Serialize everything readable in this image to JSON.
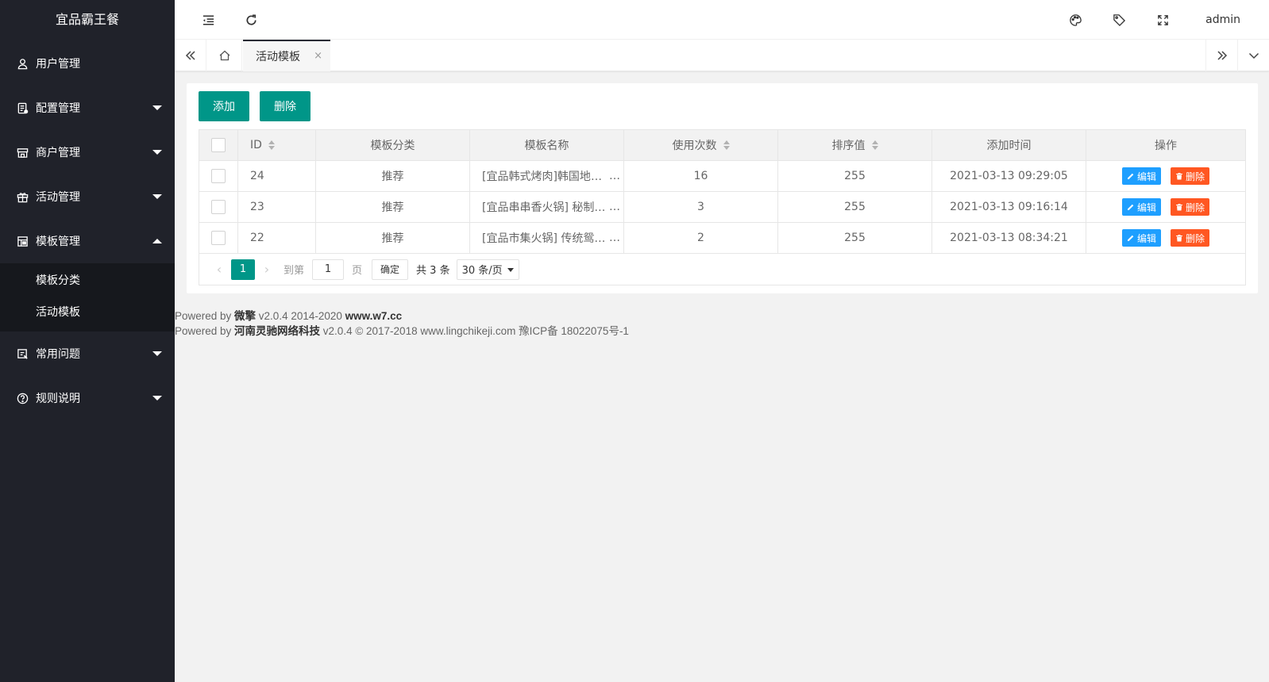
{
  "app": {
    "title": "宜品霸王餐"
  },
  "sidebar": {
    "items": [
      {
        "label": "用户管理",
        "icon": "user-icon",
        "expandable": false
      },
      {
        "label": "配置管理",
        "icon": "config-icon",
        "expandable": true
      },
      {
        "label": "商户管理",
        "icon": "shop-icon",
        "expandable": true
      },
      {
        "label": "活动管理",
        "icon": "gift-icon",
        "expandable": true
      },
      {
        "label": "模板管理",
        "icon": "template-icon",
        "expandable": true,
        "expanded": true
      },
      {
        "label": "常用问题",
        "icon": "faq-icon",
        "expandable": true
      },
      {
        "label": "规则说明",
        "icon": "help-icon",
        "expandable": true
      }
    ],
    "submenu": [
      {
        "label": "模板分类"
      },
      {
        "label": "活动模板"
      }
    ]
  },
  "header": {
    "user": "admin"
  },
  "tabs": {
    "active": "活动模板",
    "close": "×"
  },
  "toolbar": {
    "add_label": "添加",
    "delete_label": "删除"
  },
  "table": {
    "columns": [
      "ID",
      "模板分类",
      "模板名称",
      "使用次数",
      "排序值",
      "添加时间",
      "操作"
    ],
    "rows": [
      {
        "id": "24",
        "category": "推荐",
        "name": "[宜品韩式烤肉]韩国地域风情",
        "uses": "16",
        "sort": "255",
        "time": "2021-03-13 09:29:05"
      },
      {
        "id": "23",
        "category": "推荐",
        "name": "[宜品串串香火锅] 秘制锅底",
        "uses": "3",
        "sort": "255",
        "time": "2021-03-13 09:16:14"
      },
      {
        "id": "22",
        "category": "推荐",
        "name": "[宜品市集火锅] 传统鸳鸯锅",
        "uses": "2",
        "sort": "255",
        "time": "2021-03-13 08:34:21"
      }
    ],
    "edit_label": "编辑",
    "delete_label": "删除"
  },
  "pager": {
    "current": "1",
    "goto_label": "到第",
    "page_value": "1",
    "page_label": "页",
    "confirm_label": "确定",
    "count_label": "共 3 条",
    "size_label": "30 条/页"
  },
  "footer": {
    "line1_prefix": "Powered by ",
    "line1_brand": "微擎",
    "line1_mid": " v2.0.4 2014-2020 ",
    "line1_site": "www.w7.cc",
    "line2_prefix": "Powered by ",
    "line2_brand": "河南灵驰网络科技",
    "line2_rest": " v2.0.4 © 2017-2018 www.lingchikeji.com 豫ICP备 18022075号-1"
  },
  "colors": {
    "sidebar": "#20222a",
    "primary": "#009688",
    "edit": "#1e9fff",
    "danger": "#ff5722"
  }
}
